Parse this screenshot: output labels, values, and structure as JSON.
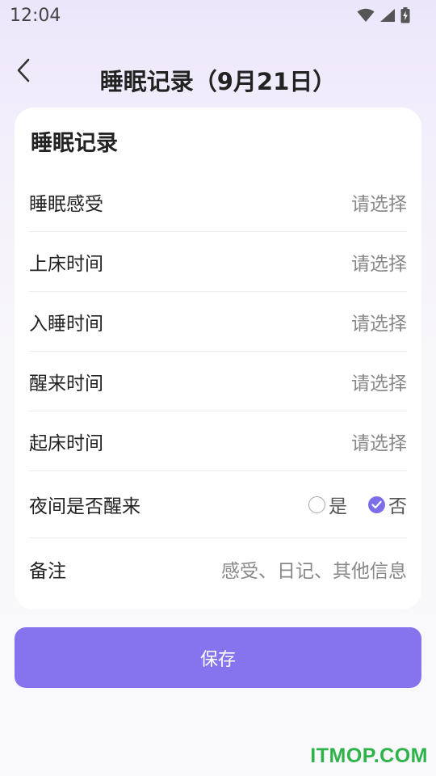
{
  "status_bar": {
    "time": "12:04",
    "icons": [
      "wifi-icon",
      "cellular-signal-icon",
      "battery-charging-icon"
    ]
  },
  "header": {
    "back_icon": "chevron-left-icon",
    "title": "睡眠记录（9月21日）"
  },
  "card": {
    "title": "睡眠记录",
    "rows": [
      {
        "label": "睡眠感受",
        "value": "请选择"
      },
      {
        "label": "上床时间",
        "value": "请选择"
      },
      {
        "label": "入睡时间",
        "value": "请选择"
      },
      {
        "label": "醒来时间",
        "value": "请选择"
      },
      {
        "label": "起床时间",
        "value": "请选择"
      }
    ],
    "night_wake": {
      "label": "夜间是否醒来",
      "options": [
        {
          "label": "是",
          "selected": false
        },
        {
          "label": "否",
          "selected": true
        }
      ]
    },
    "note": {
      "label": "备注",
      "placeholder": "感受、日记、其他信息"
    }
  },
  "save_button": {
    "label": "保存"
  },
  "watermark": "ITMOP.COM",
  "colors": {
    "accent": "#8674ee",
    "radio_checked": "#7d6de8",
    "watermark": "#2db34a"
  }
}
